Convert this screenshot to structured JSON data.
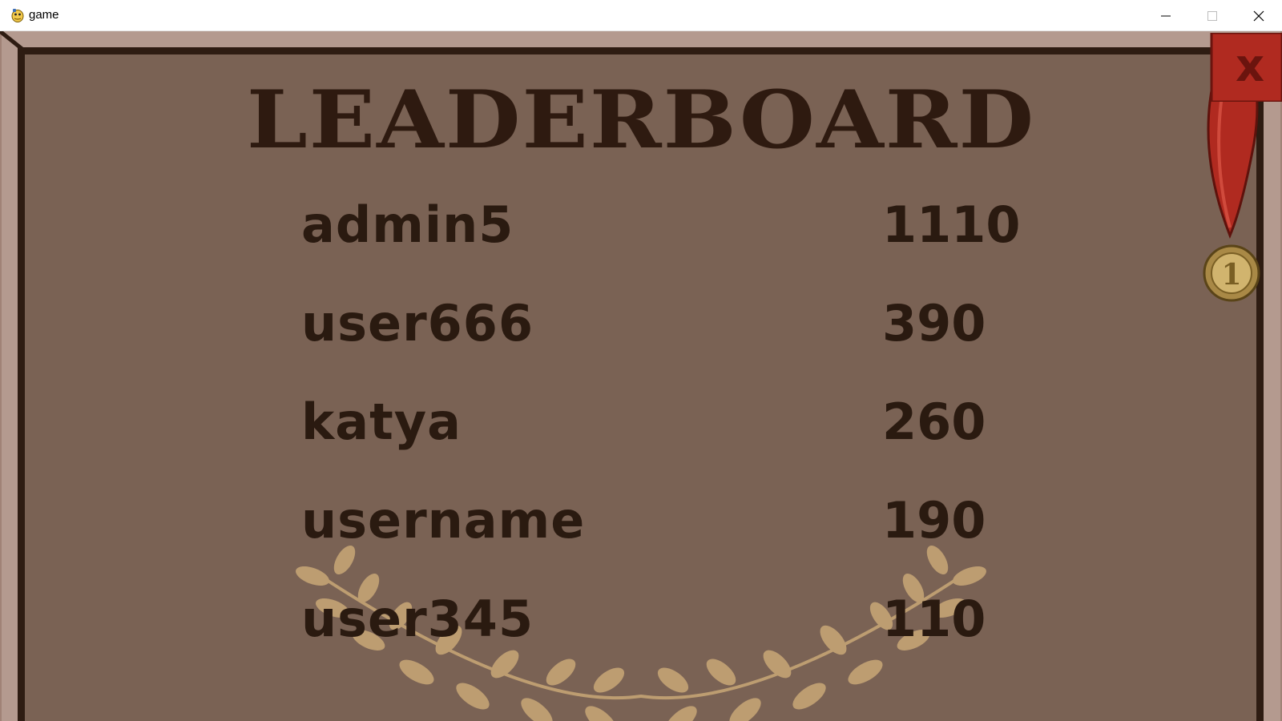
{
  "window": {
    "title": "game",
    "icons": {
      "app": "python-snake-icon",
      "minimize": "minimize-icon",
      "maximize": "maximize-icon",
      "close": "close-icon"
    }
  },
  "game": {
    "title": "LEADERBOARD",
    "close_label": "x",
    "medal_label": "1",
    "colors": {
      "board": "#7a6254",
      "frame": "#2e1c12",
      "text": "#2a1a10",
      "close_button": "#b02a20",
      "medal": "#c7a45a",
      "laurel": "#c9a877"
    },
    "entries": [
      {
        "name": "admin5",
        "score": "1110"
      },
      {
        "name": "user666",
        "score": "390"
      },
      {
        "name": "katya",
        "score": "260"
      },
      {
        "name": "username",
        "score": "190"
      },
      {
        "name": "user345",
        "score": "110"
      }
    ]
  }
}
